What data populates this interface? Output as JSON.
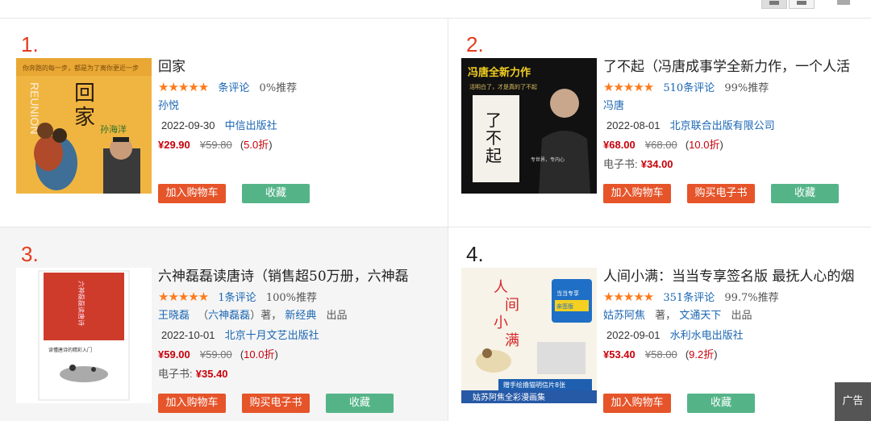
{
  "items": [
    {
      "rank": "1.",
      "title": "回家",
      "stars": "★★★★★",
      "reviews": "条评论",
      "recommend": "0%推荐",
      "author": "孙悦",
      "date": "2022-09-30",
      "publisher": "中信出版社",
      "price": "¥29.90",
      "original_price": "¥59.80",
      "discount_open": "(",
      "discount": "5.0折",
      "discount_close": ")",
      "cover_title": "回家",
      "cover_subtitle": "REUNION",
      "cover_person": "孙海洋",
      "buttons": {
        "cart": "加入购物车",
        "fav": "收藏"
      }
    },
    {
      "rank": "2.",
      "title": "了不起（冯唐成事学全新力作，一个人活",
      "stars": "★★★★★",
      "reviews": "510条评论",
      "recommend": "99%推荐",
      "author": "冯唐",
      "date": "2022-08-01",
      "publisher": "北京联合出版有限公司",
      "price": "¥68.00",
      "original_price": "¥68.00",
      "discount_open": "(",
      "discount": "10.0折",
      "discount_close": ")",
      "ebook_label": "电子书:",
      "ebook_price": "¥34.00",
      "cover_banner": "冯唐全新力作",
      "cover_book": "了不起",
      "buttons": {
        "cart": "加入购物车",
        "ebook": "购买电子书",
        "fav": "收藏"
      }
    },
    {
      "rank": "3.",
      "title": "六神磊磊读唐诗（销售超50万册，六神磊",
      "stars": "★★★★★",
      "reviews": "1条评论",
      "recommend": "100%推荐",
      "author": "王晓磊",
      "author_alias_open": "（",
      "author_alias": "六神磊磊",
      "author_alias_close": "）著，",
      "producer": "新经典",
      "producer_suffix": "出品",
      "date": "2022-10-01",
      "publisher": "北京十月文艺出版社",
      "price": "¥59.00",
      "original_price": "¥59.00",
      "discount_open": "(",
      "discount": "10.0折",
      "discount_close": ")",
      "ebook_label": "电子书:",
      "ebook_price": "¥35.40",
      "cover_book": "六神磊磊读唐诗",
      "buttons": {
        "cart": "加入购物车",
        "ebook": "购买电子书",
        "fav": "收藏"
      }
    },
    {
      "rank": "4.",
      "title": "人间小满：当当专享签名版 最抚人心的烟",
      "stars": "★★★★★",
      "reviews": "351条评论",
      "recommend": "99.7%推荐",
      "author": "姑苏阿焦",
      "author_suffix": "著，",
      "producer": "文通天下",
      "producer_suffix": "出品",
      "date": "2022-09-01",
      "publisher": "水利水电出版社",
      "price": "¥53.40",
      "original_price": "¥58.00",
      "discount_open": "(",
      "discount": "9.2折",
      "discount_close": ")",
      "cover_book": "人间小满",
      "cover_badge": "当当专享签签版",
      "cover_strip": "赠手绘撸猫明信片8张",
      "cover_bottom": "姑苏阿焦全彩漫画集",
      "buttons": {
        "cart": "加入购物车",
        "fav": "收藏"
      }
    }
  ],
  "ad_label": "广告",
  "colors": {
    "accent_red": "#e33b1f",
    "price_red": "#c7000b",
    "button_orange": "#e6542a",
    "button_green": "#54b488",
    "link_blue": "#1a66b3",
    "star_orange": "#ff7a1a"
  },
  "icons": [
    "grid-view-icon",
    "list-view-icon"
  ]
}
